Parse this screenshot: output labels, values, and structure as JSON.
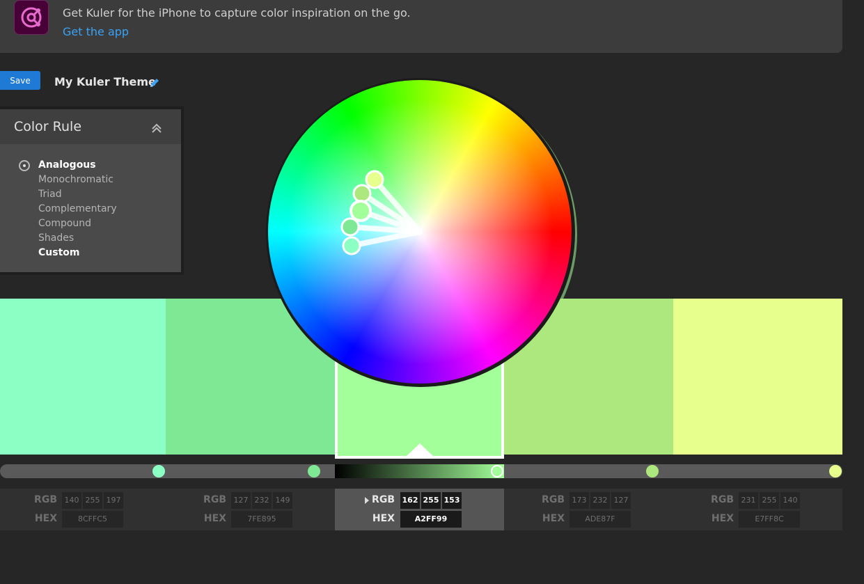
{
  "banner": {
    "text": "Get Kuler for the iPhone to capture color inspiration on the go.",
    "link": "Get the app"
  },
  "theme": {
    "save_label": "Save",
    "name": "My Kuler Theme"
  },
  "color_rule": {
    "title": "Color Rule",
    "options": [
      "Analogous",
      "Monochromatic",
      "Triad",
      "Complementary",
      "Compound",
      "Shades",
      "Custom"
    ],
    "selected": "Analogous"
  },
  "swatches": [
    {
      "hex_color": "#8CFFC5",
      "rgb": [
        "140",
        "255",
        "197"
      ],
      "hex": "8CFFC5",
      "brightness": 1.0
    },
    {
      "hex_color": "#7FE895",
      "rgb": [
        "127",
        "232",
        "149"
      ],
      "hex": "7FE895",
      "brightness": 0.91
    },
    {
      "hex_color": "#A2FF99",
      "rgb": [
        "162",
        "255",
        "153"
      ],
      "hex": "A2FF99",
      "brightness": 1.0
    },
    {
      "hex_color": "#ADE87F",
      "rgb": [
        "173",
        "232",
        "127"
      ],
      "hex": "ADE87F",
      "brightness": 0.91
    },
    {
      "hex_color": "#E7FF8C",
      "rgb": [
        "231",
        "255",
        "140"
      ],
      "hex": "E7FF8C",
      "brightness": 1.0
    }
  ],
  "selected_swatch": 2,
  "labels": {
    "rgb": "RGB",
    "hex": "HEX"
  },
  "icons": {
    "app": "kuler-app-icon",
    "edit": "pencil-icon",
    "collapse": "chevron-double-up-icon"
  }
}
